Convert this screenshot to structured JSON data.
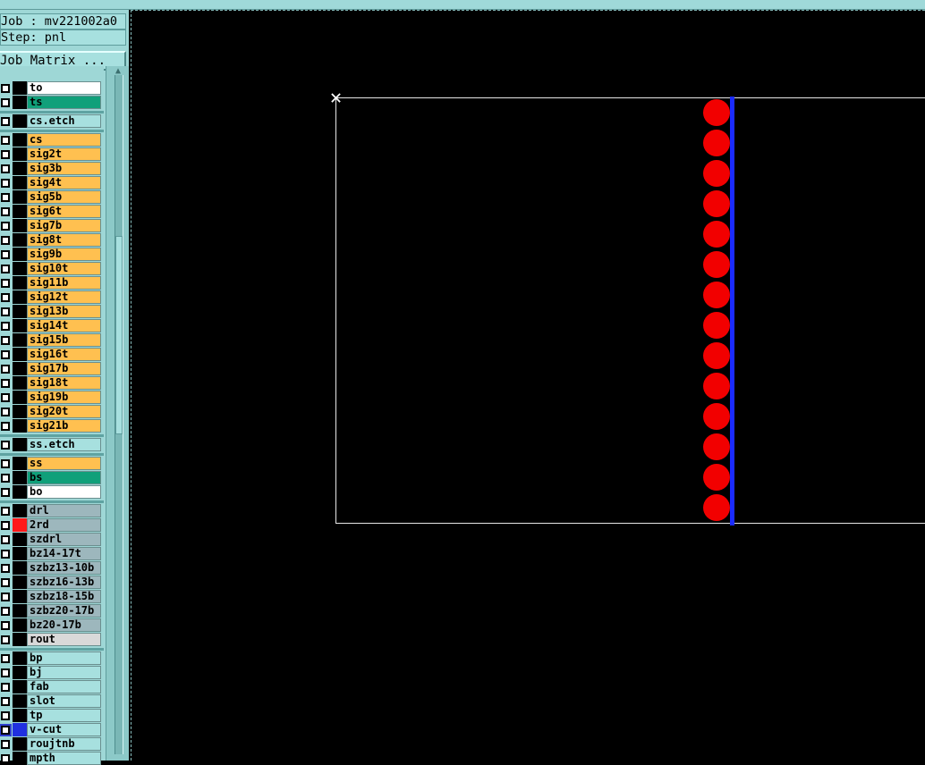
{
  "header": {
    "job_label": "Job : mv221002a0",
    "step_label": "Step: pnl",
    "matrix_button": "Job Matrix ..."
  },
  "layer_groups": [
    [
      {
        "name": "to",
        "color": "#ffffff"
      },
      {
        "name": "ts",
        "color": "#10a07a"
      }
    ],
    [
      {
        "name": "cs.etch",
        "color": "#a7e0df"
      }
    ],
    [
      {
        "name": "cs",
        "color": "#ffc050"
      },
      {
        "name": "sig2t",
        "color": "#ffc050"
      },
      {
        "name": "sig3b",
        "color": "#ffc050"
      },
      {
        "name": "sig4t",
        "color": "#ffc050"
      },
      {
        "name": "sig5b",
        "color": "#ffc050"
      },
      {
        "name": "sig6t",
        "color": "#ffc050"
      },
      {
        "name": "sig7b",
        "color": "#ffc050"
      },
      {
        "name": "sig8t",
        "color": "#ffc050"
      },
      {
        "name": "sig9b",
        "color": "#ffc050"
      },
      {
        "name": "sig10t",
        "color": "#ffc050"
      },
      {
        "name": "sig11b",
        "color": "#ffc050"
      },
      {
        "name": "sig12t",
        "color": "#ffc050"
      },
      {
        "name": "sig13b",
        "color": "#ffc050"
      },
      {
        "name": "sig14t",
        "color": "#ffc050"
      },
      {
        "name": "sig15b",
        "color": "#ffc050"
      },
      {
        "name": "sig16t",
        "color": "#ffc050"
      },
      {
        "name": "sig17b",
        "color": "#ffc050"
      },
      {
        "name": "sig18t",
        "color": "#ffc050"
      },
      {
        "name": "sig19b",
        "color": "#ffc050"
      },
      {
        "name": "sig20t",
        "color": "#ffc050"
      },
      {
        "name": "sig21b",
        "color": "#ffc050"
      }
    ],
    [
      {
        "name": "ss.etch",
        "color": "#a7e0df"
      }
    ],
    [
      {
        "name": "ss",
        "color": "#ffc050"
      },
      {
        "name": "bs",
        "color": "#10a07a"
      },
      {
        "name": "bo",
        "color": "#ffffff"
      }
    ],
    [
      {
        "name": "drl",
        "color": "#9db7bd"
      },
      {
        "name": "2rd",
        "color": "#9db7bd",
        "mark": "red"
      },
      {
        "name": "szdrl",
        "color": "#9db7bd"
      },
      {
        "name": "bz14-17t",
        "color": "#9db7bd"
      },
      {
        "name": "szbz13-10b",
        "color": "#9db7bd"
      },
      {
        "name": "szbz16-13b",
        "color": "#9db7bd"
      },
      {
        "name": "szbz18-15b",
        "color": "#9db7bd"
      },
      {
        "name": "szbz20-17b",
        "color": "#9db7bd"
      },
      {
        "name": "bz20-17b",
        "color": "#9db7bd"
      },
      {
        "name": "rout",
        "color": "#d9d9d9"
      }
    ],
    [
      {
        "name": "bp",
        "color": "#a7e0df"
      },
      {
        "name": "bj",
        "color": "#a7e0df"
      },
      {
        "name": "fab",
        "color": "#a7e0df"
      },
      {
        "name": "slot",
        "color": "#a7e0df"
      },
      {
        "name": "tp",
        "color": "#a7e0df"
      },
      {
        "name": "v-cut",
        "color": "#a7e0df",
        "mark": "blue",
        "selected": true,
        "icon": "⊞"
      },
      {
        "name": "roujtnb",
        "color": "#a7e0df"
      },
      {
        "name": "mpth",
        "color": "#a7e0df"
      }
    ]
  ],
  "scroll": {
    "up_arrow": "▲"
  },
  "canvas": {
    "origin_marker": "✕",
    "board_outline_color": "#e6e6e6",
    "vcut_line_color": "#1a2bff",
    "pad_color": "#f20000",
    "pad_count": 14
  }
}
